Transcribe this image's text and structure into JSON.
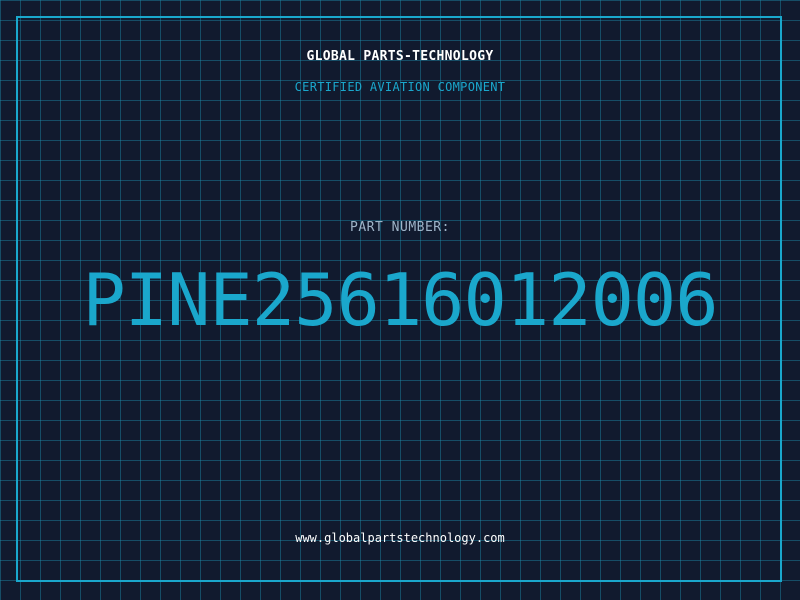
{
  "header": {
    "brand": "GLOBAL PARTS-TECHNOLOGY",
    "tagline": "CERTIFIED AVIATION COMPONENT"
  },
  "main": {
    "part_label": "PART NUMBER:",
    "part_number": "PINE25616012006"
  },
  "footer": {
    "website": "www.globalpartstechnology.com"
  },
  "colors": {
    "background": "#111a2e",
    "grid": "#1e8caa",
    "accent": "#1aa7cc",
    "brand_text": "#ffffff",
    "label_text": "#9fb4c8"
  }
}
